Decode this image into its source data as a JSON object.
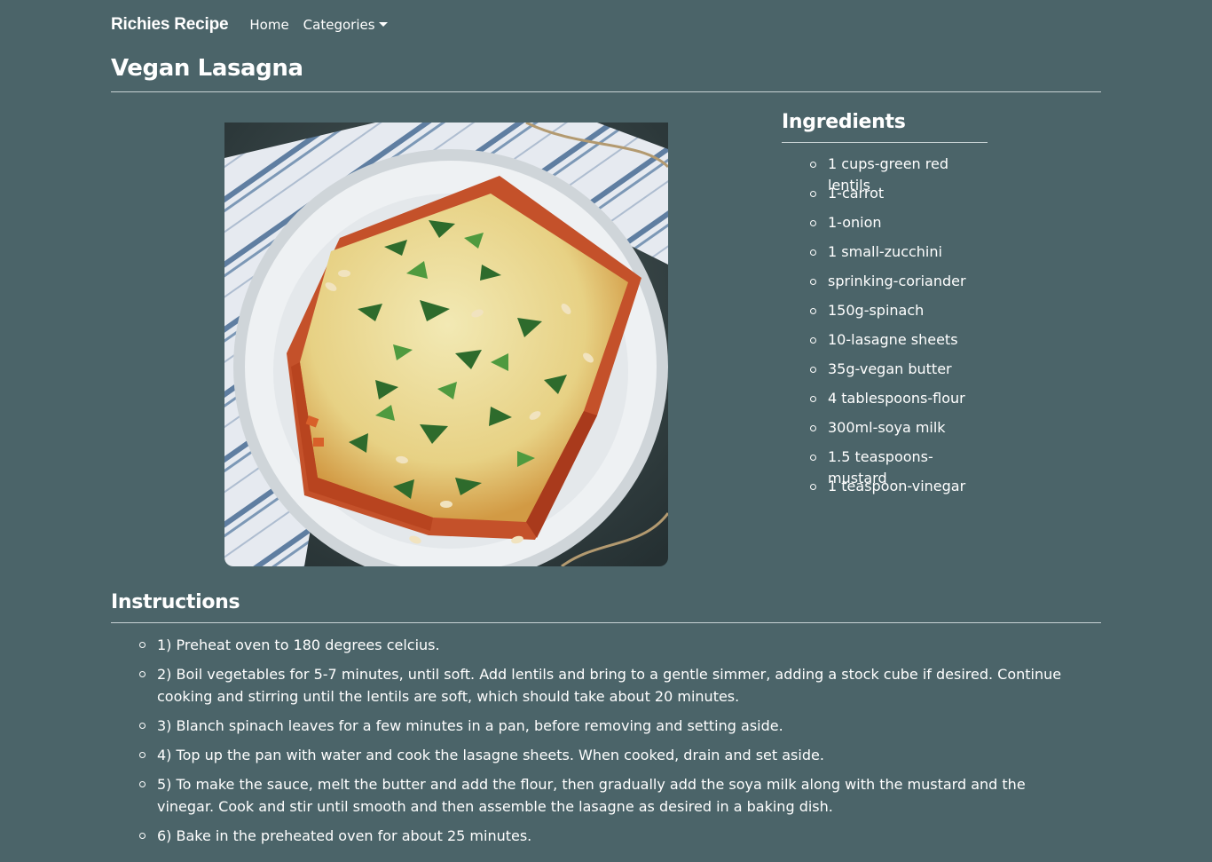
{
  "nav": {
    "brand": "Richies Recipe",
    "links": [
      "Home",
      "Categories"
    ]
  },
  "recipe": {
    "title": "Vegan Lasagna",
    "image_description": "vegan-lasagna-plate-photo"
  },
  "ingredients": {
    "heading": "Ingredients",
    "items": [
      "1 cups-green red lentils",
      "1-carrot",
      "1-onion",
      "1 small-zucchini",
      "sprinking-coriander",
      "150g-spinach",
      "10-lasagne sheets",
      "35g-vegan butter",
      "4 tablespoons-flour",
      "300ml-soya milk",
      "1.5 teaspoons-mustard",
      "1 teaspoon-vinegar"
    ]
  },
  "instructions": {
    "heading": "Instructions",
    "steps": [
      "1) Preheat oven to 180 degrees celcius.",
      "2) Boil vegetables for 5-7 minutes, until soft. Add lentils and bring to a gentle simmer, adding a stock cube if desired. Continue cooking and stirring until the lentils are soft, which should take about 20 minutes.",
      "3) Blanch spinach leaves for a few minutes in a pan, before removing and setting aside.",
      "4) Top up the pan with water and cook the lasagne sheets. When cooked, drain and set aside.",
      "5) To make the sauce, melt the butter and add the flour, then gradually add the soya milk along with the mustard and the vinegar. Cook and stir until smooth and then assemble the lasagne as desired in a baking dish.",
      "6) Bake in the preheated oven for about 25 minutes."
    ]
  },
  "colors": {
    "background": "#4b6469",
    "text": "#ffffff",
    "rule": "#c7d2d4"
  }
}
